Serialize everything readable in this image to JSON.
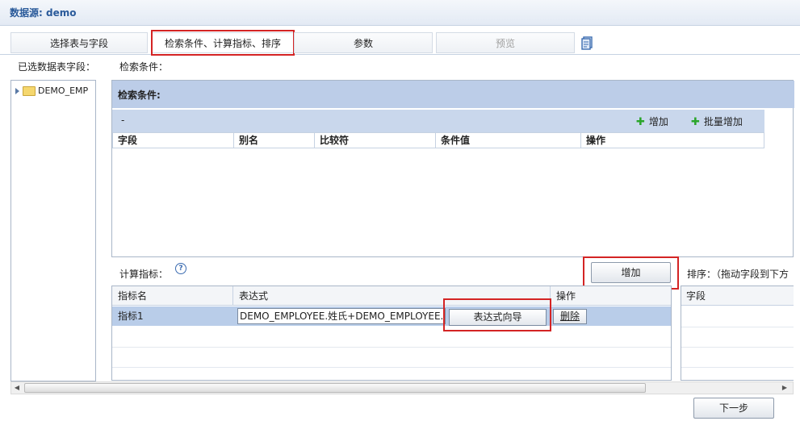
{
  "header": {
    "title": "数据源: demo"
  },
  "tabs": [
    {
      "label": "选择表与字段"
    },
    {
      "label": "检索条件、计算指标、排序"
    },
    {
      "label": "参数"
    },
    {
      "label": "预览"
    }
  ],
  "tab_icon": "document-icon",
  "left_panel": {
    "label": "已选数据表字段：",
    "tree": [
      {
        "label": "DEMO_EMP"
      }
    ]
  },
  "search_condition": {
    "label": "检索条件：",
    "panel_title": "检索条件:",
    "toolbar_dash": "-",
    "add_label": "增加",
    "batch_add_label": "批量增加",
    "columns": [
      "字段",
      "别名",
      "比较符",
      "条件值",
      "操作"
    ]
  },
  "calc": {
    "label": "计算指标：",
    "help": "?",
    "add_label": "增加",
    "columns": [
      "指标名",
      "表达式",
      "操作"
    ],
    "rows": [
      {
        "name": "指标1",
        "expression": "DEMO_EMPLOYEE.姓氏+DEMO_EMPLOYEE.名",
        "wizard_label": "表达式向导",
        "delete_label": "删除"
      }
    ]
  },
  "sort": {
    "label": "排序：（拖动字段到下方",
    "columns": [
      "字段"
    ]
  },
  "scroll": {
    "left": "◀",
    "right": "▶"
  },
  "footer": {
    "next_label": "下一步"
  }
}
